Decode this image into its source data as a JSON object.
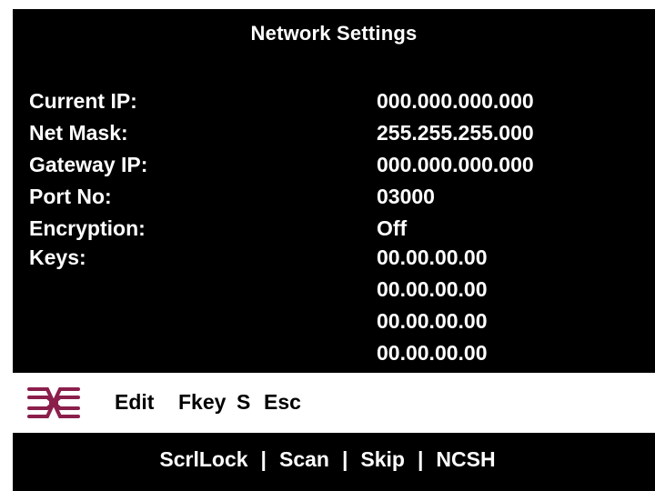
{
  "title": "Network Settings",
  "fields": [
    {
      "label": "Current IP:",
      "value": "000.000.000.000"
    },
    {
      "label": "Net Mask:",
      "value": "255.255.255.000"
    },
    {
      "label": "Gateway IP:",
      "value": "000.000.000.000"
    },
    {
      "label": "Port No:",
      "value": "03000"
    },
    {
      "label": "Encryption:",
      "value": "Off"
    },
    {
      "label": "Keys:",
      "value": "00.00.00.00"
    }
  ],
  "extra_keys": [
    "00.00.00.00",
    "00.00.00.00",
    "00.00.00.00"
  ],
  "command_bar": {
    "logo_icon": "network-logo-icon",
    "edit": "Edit",
    "fkey": "Fkey",
    "s": "S",
    "esc": "Esc"
  },
  "function_keys": [
    "ScrlLock",
    "Scan",
    "Skip",
    "NCSH"
  ],
  "separator": "|",
  "colors": {
    "background": "#000000",
    "text": "#ffffff",
    "logo": "#8b1f4b"
  }
}
